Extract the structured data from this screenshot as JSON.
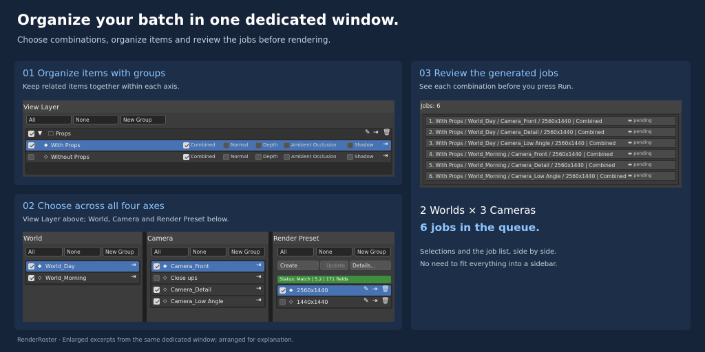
{
  "header": {
    "title": "Organize your batch in one dedicated window.",
    "subtitle": "Choose combinations, organize items and review the jobs before rendering."
  },
  "panel1": {
    "title": "01 Organize items with groups",
    "desc": "Keep related items together within each axis.",
    "mock": {
      "header": "View Layer",
      "all": "All",
      "none": "None",
      "new_group": "New Group",
      "group_name": "Props",
      "rows": [
        {
          "name": "With Props",
          "selected": true,
          "checked": true,
          "marker": "◆",
          "passes": [
            {
              "label": "Combined",
              "on": true
            },
            {
              "label": "Normal",
              "on": false
            },
            {
              "label": "Depth",
              "on": false
            },
            {
              "label": "Ambient Occlusion",
              "on": false
            },
            {
              "label": "Shadow",
              "on": false
            }
          ]
        },
        {
          "name": "Without Props",
          "selected": false,
          "checked": false,
          "marker": "◇",
          "passes": [
            {
              "label": "Combined",
              "on": true
            },
            {
              "label": "Normal",
              "on": false
            },
            {
              "label": "Depth",
              "on": false
            },
            {
              "label": "Ambient Occlusion",
              "on": false
            },
            {
              "label": "Shadow",
              "on": false
            }
          ]
        }
      ]
    }
  },
  "panel2": {
    "title": "02 Choose across all four axes",
    "desc": "View Layer above; World, Camera and Render Preset below.",
    "world": {
      "header": "World",
      "all": "All",
      "none": "None",
      "new_group": "New Group",
      "items": [
        "World_Day",
        "World_Morning"
      ]
    },
    "camera": {
      "header": "Camera",
      "all": "All",
      "none": "None",
      "new_group": "New Group",
      "items": [
        "Camera_Front",
        "Close ups",
        "Camera_Detail",
        "Camera_Low Angle"
      ]
    },
    "preset": {
      "header": "Render Preset",
      "all": "All",
      "none": "None",
      "new_group": "New Group",
      "create": "Create",
      "update": "Update",
      "details": "Details...",
      "status": "Status: Match | 5.2 | 171 fields",
      "items": [
        "2560x1440",
        "1440x1440"
      ]
    }
  },
  "panel3": {
    "title": "03 Review the generated jobs",
    "desc": "See each combination before you press Run.",
    "jobs_header": "Jobs: 6",
    "jobs": [
      {
        "label": "1. With Props / World_Day / Camera_Front / 2560x1440 | Combined",
        "status": "pending"
      },
      {
        "label": "2. With Props / World_Day / Camera_Detail / 2560x1440 | Combined",
        "status": "pending"
      },
      {
        "label": "3. With Props / World_Day / Camera_Low Angle / 2560x1440 | Combined",
        "status": "pending"
      },
      {
        "label": "4. With Props / World_Morning / Camera_Front / 2560x1440 | Combined",
        "status": "pending"
      },
      {
        "label": "5. With Props / World_Morning / Camera_Detail / 2560x1440 | Combined",
        "status": "pending"
      },
      {
        "label": "6. With Props / World_Morning / Camera_Low Angle / 2560x1440 | Combined",
        "status": "pending"
      }
    ],
    "summary_line1": "2 Worlds × 3 Cameras",
    "summary_line2": "6 jobs in the queue.",
    "note_line1": "Selections and the job list, side by side.",
    "note_line2": "No need to fit everything into a sidebar."
  },
  "footer": "RenderRoster · Enlarged excerpts from the same dedicated window; arranged for explanation."
}
